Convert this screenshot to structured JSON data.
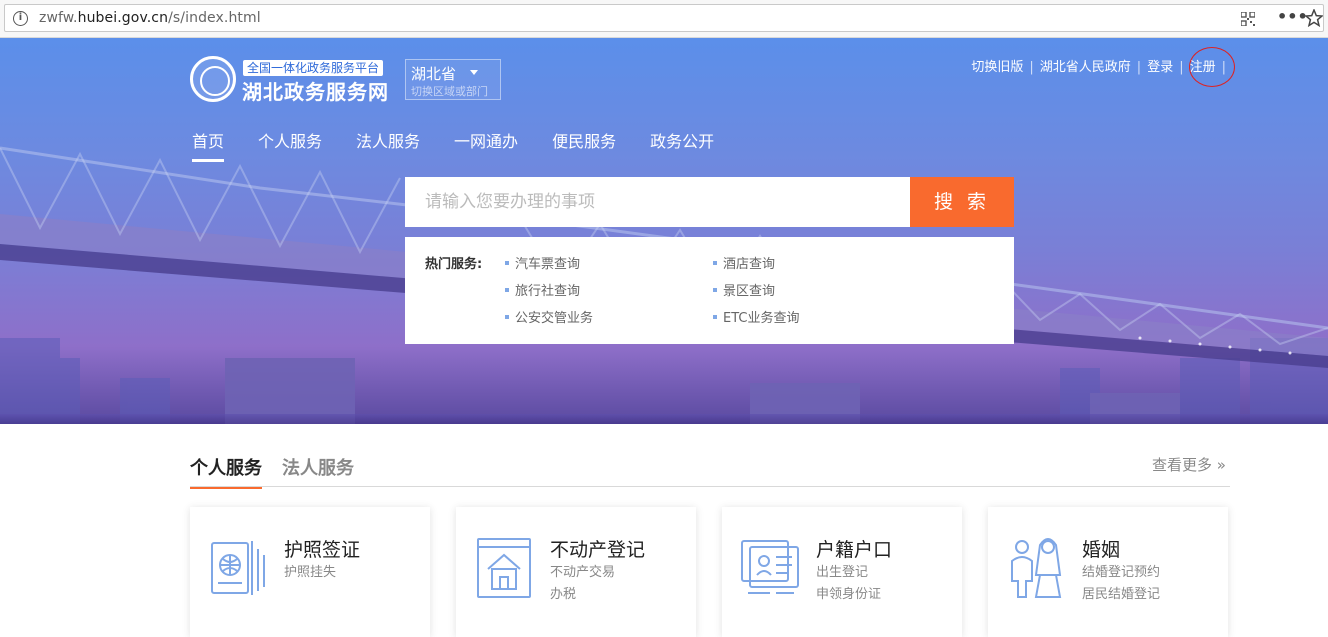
{
  "browser": {
    "url_prefix": "zwfw.",
    "url_domain": "hubei.gov.cn",
    "url_path": "/s/index.html"
  },
  "header": {
    "logo_tag": "全国一体化政务服务平台",
    "logo_title": "湖北政务服务网",
    "region_name": "湖北省",
    "region_sub": "切换区域或部门",
    "links": [
      "切换旧版",
      "湖北省人民政府",
      "登录",
      "注册"
    ]
  },
  "nav": {
    "items": [
      "首页",
      "个人服务",
      "法人服务",
      "一网通办",
      "便民服务",
      "政务公开"
    ],
    "active_index": 0
  },
  "search": {
    "placeholder": "请输入您要办理的事项",
    "button_label": "搜 索"
  },
  "hot_services": {
    "label": "热门服务:",
    "items": [
      "汽车票查询",
      "酒店查询",
      "旅行社查询",
      "景区查询",
      "公安交管业务",
      "ETC业务查询"
    ]
  },
  "services": {
    "tabs": [
      "个人服务",
      "法人服务"
    ],
    "more": "查看更多 »",
    "cards": [
      {
        "icon": "passport-icon",
        "title": "护照签证",
        "subs": [
          "护照挂失"
        ]
      },
      {
        "icon": "house-icon",
        "title": "不动产登记",
        "subs": [
          "不动产交易",
          "办税"
        ]
      },
      {
        "icon": "household-register-icon",
        "title": "户籍户口",
        "subs": [
          "出生登记",
          "申领身份证"
        ]
      },
      {
        "icon": "marriage-icon",
        "title": "婚姻",
        "subs": [
          "结婚登记预约",
          "居民结婚登记"
        ]
      }
    ]
  },
  "colors": {
    "accent": "#f96a2e",
    "brand_blue": "#2f6ad9",
    "icon_blue": "#7fa7e6"
  }
}
